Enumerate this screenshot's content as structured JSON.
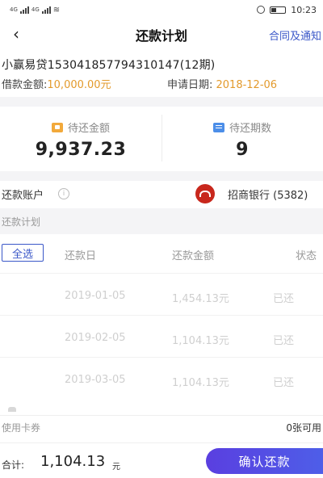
{
  "status_bar": {
    "network_left": "4G",
    "network_right": "4G",
    "time": "10:23"
  },
  "nav": {
    "title": "还款计划",
    "right_link": "合同及通知"
  },
  "loan": {
    "name": "小赢易贷153041857794310147(12期)",
    "amount_label": "借款金额: ",
    "amount_value": "10,000.00元",
    "date_label": "申请日期: ",
    "date_value": "2018-12-06"
  },
  "summary": {
    "pending_amount_label": "待还金额",
    "pending_amount_value": "9,937.23",
    "pending_periods_label": "待还期数",
    "pending_periods_value": "9"
  },
  "account": {
    "label": "还款账户",
    "bank": "招商银行 (5382)"
  },
  "plan": {
    "header": "还款计划",
    "select_all": "全选",
    "columns": {
      "date": "还款日",
      "amount": "还款金额",
      "status": "状态"
    },
    "rows": [
      {
        "date": "2019-01-05",
        "amount": "1,454.13元",
        "status": "已还"
      },
      {
        "date": "2019-02-05",
        "amount": "1,104.13元",
        "status": "已还"
      },
      {
        "date": "2019-03-05",
        "amount": "1,104.13元",
        "status": "已还"
      }
    ]
  },
  "voucher": {
    "label": "使用卡券",
    "value": "0张可用"
  },
  "footer": {
    "total_label": "合计:",
    "total_value": "1,104.13",
    "total_unit": "元",
    "confirm_label": "确认还款"
  },
  "colors": {
    "accent": "#3a57c8",
    "amount_orange": "#e39a2c",
    "button_gradient_start": "#5a3fe0",
    "button_gradient_end": "#4e5ee8",
    "bank_red": "#c8271c"
  }
}
